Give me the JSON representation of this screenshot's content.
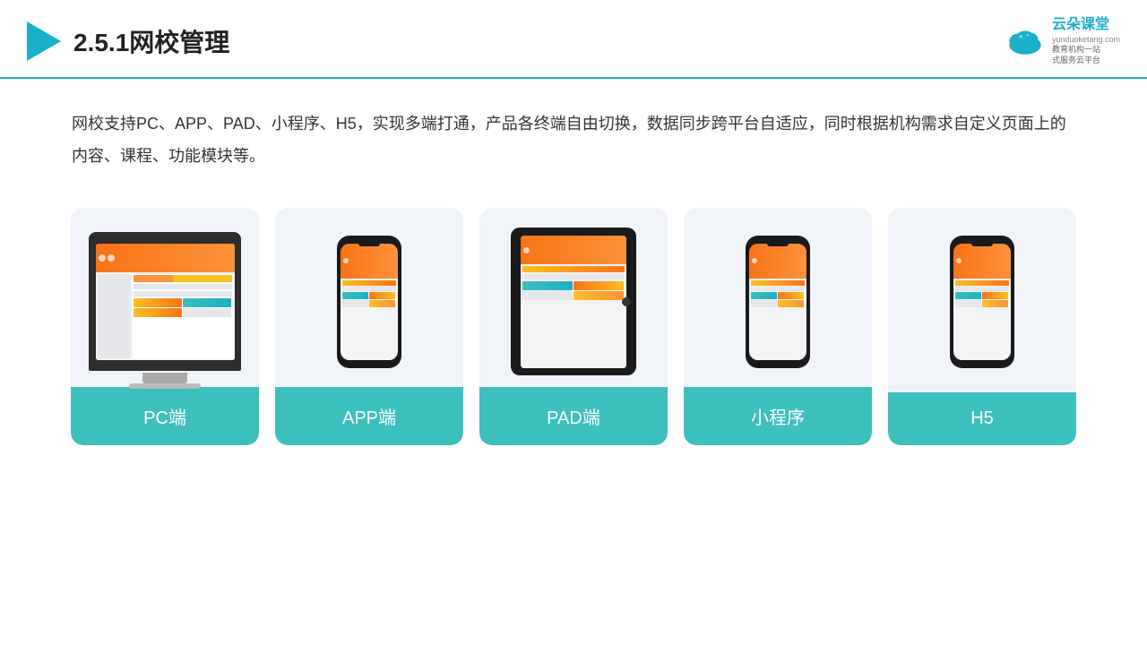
{
  "header": {
    "title": "2.5.1网校管理",
    "brand": {
      "name": "云朵课堂",
      "domain": "yunduoketang.com",
      "tagline1": "教育机构一站",
      "tagline2": "式服务云平台"
    }
  },
  "description": {
    "text": "网校支持PC、APP、PAD、小程序、H5，实现多端打通，产品各终端自由切换，数据同步跨平台自适应，同时根据机构需求自定义页面上的内容、课程、功能模块等。"
  },
  "cards": [
    {
      "id": "pc",
      "label": "PC端",
      "type": "desktop"
    },
    {
      "id": "app",
      "label": "APP端",
      "type": "phone"
    },
    {
      "id": "pad",
      "label": "PAD端",
      "type": "tablet"
    },
    {
      "id": "miniapp",
      "label": "小程序",
      "type": "phone"
    },
    {
      "id": "h5",
      "label": "H5",
      "type": "phone"
    }
  ],
  "colors": {
    "accent": "#3dbfbd",
    "header_line": "#1ab0c8",
    "play_icon": "#1ab0c8",
    "brand_color": "#1ab0c8"
  }
}
